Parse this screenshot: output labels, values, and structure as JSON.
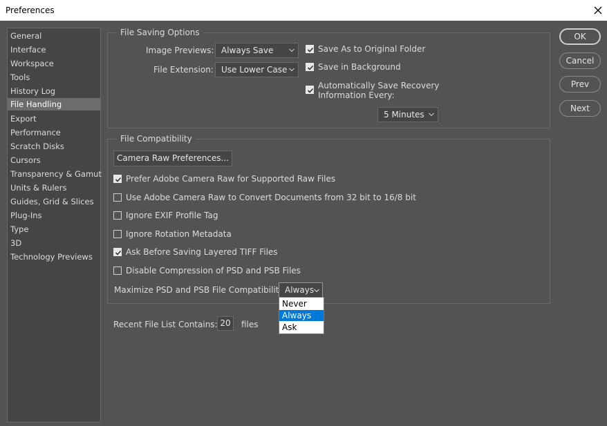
{
  "window": {
    "title": "Preferences",
    "close_icon": "close-icon"
  },
  "sidebar": {
    "items": [
      {
        "label": "General"
      },
      {
        "label": "Interface"
      },
      {
        "label": "Workspace"
      },
      {
        "label": "Tools"
      },
      {
        "label": "History Log"
      },
      {
        "label": "File Handling",
        "selected": true
      },
      {
        "label": "Export"
      },
      {
        "label": "Performance"
      },
      {
        "label": "Scratch Disks"
      },
      {
        "label": "Cursors"
      },
      {
        "label": "Transparency & Gamut"
      },
      {
        "label": "Units & Rulers"
      },
      {
        "label": "Guides, Grid & Slices"
      },
      {
        "label": "Plug-Ins"
      },
      {
        "label": "Type"
      },
      {
        "label": "3D"
      },
      {
        "label": "Technology Previews"
      }
    ]
  },
  "file_saving": {
    "title": "File Saving Options",
    "image_previews_label": "Image Previews:",
    "image_previews_value": "Always Save",
    "file_extension_label": "File Extension:",
    "file_extension_value": "Use Lower Case",
    "save_as_original": {
      "label": "Save As to Original Folder",
      "checked": true
    },
    "save_in_background": {
      "label": "Save in Background",
      "checked": true
    },
    "auto_recovery": {
      "label_line1": "Automatically Save Recovery",
      "label_line2": "Information Every:",
      "checked": true
    },
    "recovery_interval": "5 Minutes"
  },
  "file_compat": {
    "title": "File Compatibility",
    "camera_raw_button": "Camera Raw Preferences...",
    "options": [
      {
        "label": "Prefer Adobe Camera Raw for Supported Raw Files",
        "checked": true
      },
      {
        "label": "Use Adobe Camera Raw to Convert Documents from 32 bit to 16/8 bit",
        "checked": false
      },
      {
        "label": "Ignore EXIF Profile Tag",
        "checked": false
      },
      {
        "label": "Ignore Rotation Metadata",
        "checked": false
      },
      {
        "label": "Ask Before Saving Layered TIFF Files",
        "checked": true
      },
      {
        "label": "Disable Compression of PSD and PSB Files",
        "checked": false
      }
    ],
    "maximize_label": "Maximize PSD and PSB File Compatibility:",
    "maximize_value": "Always",
    "maximize_options": [
      "Never",
      "Always",
      "Ask"
    ],
    "maximize_selected": "Always"
  },
  "recent": {
    "label": "Recent File List Contains:",
    "value": "20",
    "suffix": "files"
  },
  "buttons": {
    "ok": "OK",
    "cancel": "Cancel",
    "prev": "Prev",
    "next": "Next"
  },
  "colors": {
    "background": "#535353",
    "panel": "#454545",
    "selection_blue": "#0078d7"
  }
}
